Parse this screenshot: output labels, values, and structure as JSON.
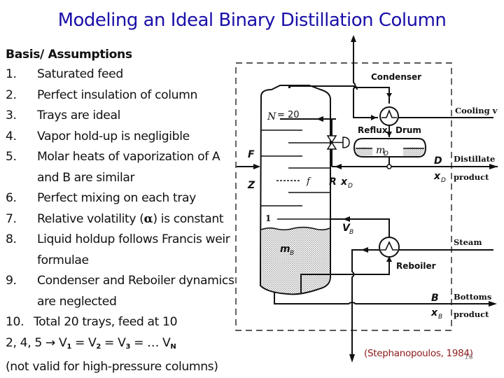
{
  "title": "Modeling an Ideal Binary Distillation Column",
  "assumptions": {
    "heading": "Basis/ Assumptions",
    "items": [
      {
        "num": "1.",
        "text": "Saturated feed"
      },
      {
        "num": "2.",
        "text": "Perfect insulation of column"
      },
      {
        "num": "3.",
        "text": "Trays are ideal"
      },
      {
        "num": "4.",
        "text": "Vapor hold-up is negligible"
      },
      {
        "num": "5.",
        "text": "Molar heats of vaporization of A",
        "cont": "and B are similar"
      },
      {
        "num": "6.",
        "text": "Perfect mixing on each tray"
      },
      {
        "num": "7.",
        "text_before": "Relative volatility (",
        "symbol": "α",
        "text_after": ") is constant"
      },
      {
        "num": "8.",
        "text": "Liquid holdup follows Francis weir",
        "cont": "formulae"
      },
      {
        "num": "9.",
        "text": "Condenser and Reboiler dynamics",
        "cont": "are neglected"
      },
      {
        "num": "10.",
        "text": "Total 20 trays, feed at 10"
      }
    ],
    "equation": {
      "prefix": "2, 4, 5 → V",
      "s1": "1",
      "p2": " = V",
      "s2": "2",
      "p3": " = V",
      "s3": "3",
      "p4": " = … V",
      "sN": "N"
    },
    "note": "(not valid for high-pressure columns)"
  },
  "diagram": {
    "condenser": "Condenser",
    "reflux": "Reflux",
    "drum": "Drum",
    "cooling": "Cooling v",
    "n_label": "N",
    "n_value": "= 20",
    "feed_F": "F",
    "feed_Z": "Z",
    "feed_tray": "f",
    "tray_1": "1",
    "reflux_R": "R",
    "x": "x",
    "sub_D": "D",
    "sub_B": "B",
    "m": "m",
    "V": "V",
    "D": "D",
    "B": "B",
    "distillate": "Distillate",
    "product": "product",
    "steam": "Steam",
    "reboiler": "Reboiler",
    "bottoms": "Bottoms"
  },
  "citation": "(Stephanopoulos, 1984)",
  "page_number": "16",
  "colors": {
    "title": "#1a0fa8",
    "citation": "#8b1a1a",
    "page_number": "#888888"
  }
}
